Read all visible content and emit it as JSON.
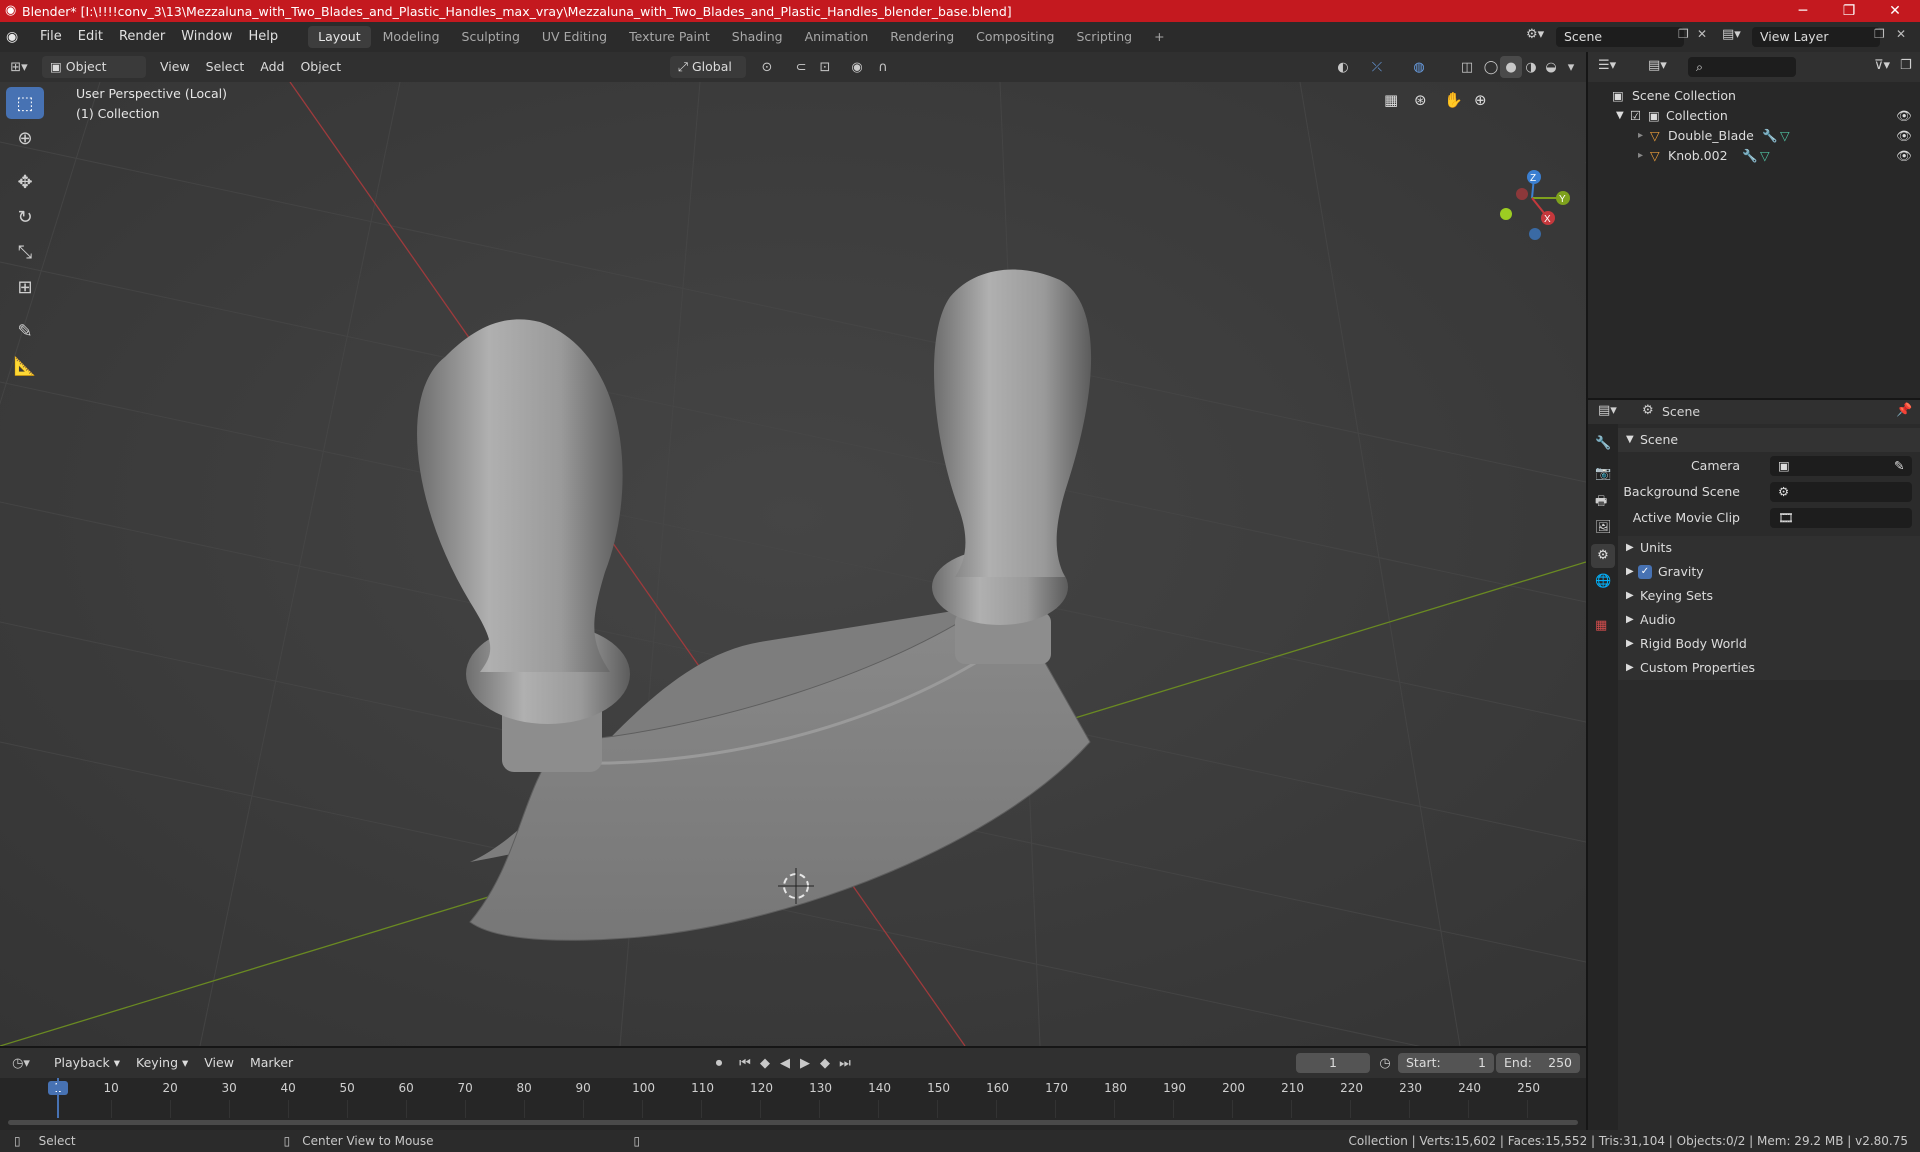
{
  "window": {
    "title": "Blender* [I:\\!!!!conv_3\\13\\Mezzaluna_with_Two_Blades_and_Plastic_Handles_max_vray\\Mezzaluna_with_Two_Blades_and_Plastic_Handles_blender_base.blend]",
    "minimize_icon": "minimize-icon",
    "maximize_icon": "restore-icon",
    "close_icon": "close-icon"
  },
  "menubar": {
    "items": [
      "File",
      "Edit",
      "Render",
      "Window",
      "Help"
    ],
    "workspaces": [
      "Layout",
      "Modeling",
      "Sculpting",
      "UV Editing",
      "Texture Paint",
      "Shading",
      "Animation",
      "Rendering",
      "Compositing",
      "Scripting"
    ],
    "active_workspace": "Layout",
    "add_tab": "+",
    "scene": "Scene",
    "view_layer": "View Layer"
  },
  "viewport_header": {
    "mode": "Object Mode",
    "menus": [
      "View",
      "Select",
      "Add",
      "Object"
    ],
    "orientation": "Global"
  },
  "viewport": {
    "perspective": "User Perspective (Local)",
    "collection": "(1) Collection",
    "gizmo": {
      "x": "X",
      "y": "Y",
      "z": "Z"
    }
  },
  "outliner": {
    "search_placeholder": "",
    "root": "Scene Collection",
    "collection": "Collection",
    "objects": [
      "Double_Blade",
      "Knob.002"
    ]
  },
  "properties": {
    "context": "Scene",
    "panel": "Scene",
    "camera_label": "Camera",
    "background_label": "Background Scene",
    "movieclip_label": "Active Movie Clip",
    "sections": [
      "Units",
      "Gravity",
      "Keying Sets",
      "Audio",
      "Rigid Body World",
      "Custom Properties"
    ],
    "gravity_checked": true
  },
  "timeline": {
    "menus": [
      "Playback",
      "Keying",
      "View",
      "Marker"
    ],
    "current_frame": "1",
    "start_label": "Start:",
    "start": "1",
    "end_label": "End:",
    "end": "250",
    "ticks": [
      "1",
      "10",
      "20",
      "30",
      "40",
      "50",
      "60",
      "70",
      "80",
      "90",
      "100",
      "110",
      "120",
      "130",
      "140",
      "150",
      "160",
      "170",
      "180",
      "190",
      "200",
      "210",
      "220",
      "230",
      "240",
      "250"
    ]
  },
  "statusbar": {
    "select": "Select",
    "center_view": "Center View to Mouse",
    "stats": "Collection | Verts:15,602 | Faces:15,552 | Tris:31,104 | Objects:0/2 | Mem: 29.2 MB | v2.80.75"
  },
  "colors": {
    "titlebar": "#c4191f",
    "accent": "#4772b3",
    "x_axis": "#c5383c",
    "y_axis": "#7ea11d",
    "z_axis": "#3b7fd1"
  }
}
